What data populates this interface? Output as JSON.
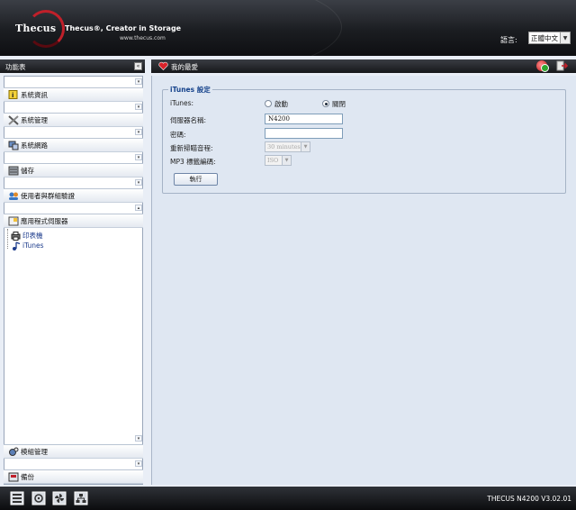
{
  "header": {
    "logo": "Thecus",
    "tagline": "Thecus®, Creator in Storage",
    "url": "www.thecus.com",
    "language_label": "語言:",
    "language_value": "正體中文"
  },
  "left": {
    "title": "功能表",
    "menu": [
      {
        "label": "系統資訊",
        "icon": "info-icon"
      },
      {
        "label": "系統管理",
        "icon": "tools-icon"
      },
      {
        "label": "系統網路",
        "icon": "network-icon"
      },
      {
        "label": "儲存",
        "icon": "storage-icon"
      },
      {
        "label": "使用者與群組驗證",
        "icon": "users-icon"
      },
      {
        "label": "應用程式伺服器",
        "icon": "app-server-icon"
      }
    ],
    "tree": [
      {
        "label": "印表機",
        "icon": "printer-icon"
      },
      {
        "label": "iTunes",
        "icon": "music-note-icon"
      }
    ],
    "bottom_menu": [
      {
        "label": "模組管理",
        "icon": "module-icon"
      },
      {
        "label": "備份",
        "icon": "backup-icon"
      }
    ]
  },
  "right": {
    "title": "我的最愛",
    "section_title": "iTunes 設定",
    "itunes_label": "iTunes:",
    "enable_label": "啟動",
    "disable_label": "關閉",
    "server_name_label": "伺服器名稱:",
    "server_name_value": "N4200",
    "password_label": "密碼:",
    "password_value": "",
    "rescan_label": "重新掃瞄音程:",
    "rescan_value": "30 minutes",
    "mp3_label": "MP3 標籤編碼:",
    "mp3_value": "ISO",
    "apply_label": "執行"
  },
  "footer": {
    "version": "THECUS N4200 V3.02.01"
  },
  "colors": {
    "accent": "#15428b",
    "header_dark": "#16171a",
    "panel_bg": "#dfe7f2",
    "logo_red": "#c0202a"
  }
}
